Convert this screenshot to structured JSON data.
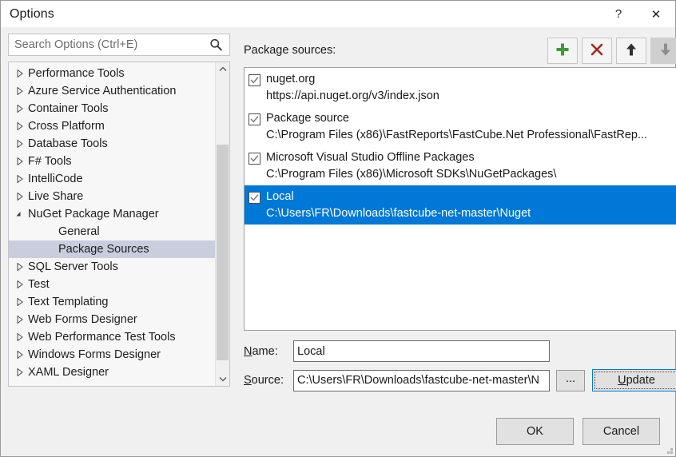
{
  "window": {
    "title": "Options",
    "help_button": "?",
    "close_button": "✕"
  },
  "search": {
    "placeholder": "Search Options (Ctrl+E)",
    "value": "",
    "icon": "search-icon"
  },
  "tree": {
    "items": [
      {
        "label": "Performance Tools",
        "state": "collapsed",
        "level": 0,
        "selected": false
      },
      {
        "label": "Azure Service Authentication",
        "state": "collapsed",
        "level": 0,
        "selected": false
      },
      {
        "label": "Container Tools",
        "state": "collapsed",
        "level": 0,
        "selected": false
      },
      {
        "label": "Cross Platform",
        "state": "collapsed",
        "level": 0,
        "selected": false
      },
      {
        "label": "Database Tools",
        "state": "collapsed",
        "level": 0,
        "selected": false
      },
      {
        "label": "F# Tools",
        "state": "collapsed",
        "level": 0,
        "selected": false
      },
      {
        "label": "IntelliCode",
        "state": "collapsed",
        "level": 0,
        "selected": false
      },
      {
        "label": "Live Share",
        "state": "collapsed",
        "level": 0,
        "selected": false
      },
      {
        "label": "NuGet Package Manager",
        "state": "expanded",
        "level": 0,
        "selected": false
      },
      {
        "label": "General",
        "state": "leaf",
        "level": 1,
        "selected": false
      },
      {
        "label": "Package Sources",
        "state": "leaf",
        "level": 1,
        "selected": true
      },
      {
        "label": "SQL Server Tools",
        "state": "collapsed",
        "level": 0,
        "selected": false
      },
      {
        "label": "Test",
        "state": "collapsed",
        "level": 0,
        "selected": false
      },
      {
        "label": "Text Templating",
        "state": "collapsed",
        "level": 0,
        "selected": false
      },
      {
        "label": "Web Forms Designer",
        "state": "collapsed",
        "level": 0,
        "selected": false
      },
      {
        "label": "Web Performance Test Tools",
        "state": "collapsed",
        "level": 0,
        "selected": false
      },
      {
        "label": "Windows Forms Designer",
        "state": "collapsed",
        "level": 0,
        "selected": false
      },
      {
        "label": "XAML Designer",
        "state": "collapsed",
        "level": 0,
        "selected": false
      }
    ],
    "scrollbar": {
      "up_icon": "chevron-up-icon",
      "down_icon": "chevron-down-icon"
    }
  },
  "packages": {
    "header_label": "Package sources:",
    "toolbar": [
      {
        "name": "add-package-source-button",
        "icon": "plus-icon",
        "color": "#3d9b35",
        "disabled": false
      },
      {
        "name": "remove-package-source-button",
        "icon": "x-icon",
        "color": "#a02b17",
        "disabled": false
      },
      {
        "name": "move-up-button",
        "icon": "arrow-up-icon",
        "color": "#303030",
        "disabled": false
      },
      {
        "name": "move-down-button",
        "icon": "arrow-down-icon",
        "color": "#8d8d8d",
        "disabled": true
      }
    ],
    "sources": [
      {
        "name": "nuget.org",
        "url": "https://api.nuget.org/v3/index.json",
        "checked": true,
        "selected": false
      },
      {
        "name": "Package source",
        "url": "C:\\Program  Files  (x86)\\FastReports\\FastCube.Net  Professional\\FastRep...",
        "checked": true,
        "selected": false
      },
      {
        "name": "Microsoft Visual Studio Offline Packages",
        "url": "C:\\Program Files (x86)\\Microsoft SDKs\\NuGetPackages\\",
        "checked": true,
        "selected": false
      },
      {
        "name": "Local",
        "url": "C:\\Users\\FR\\Downloads\\fastcube-net-master\\Nuget",
        "checked": true,
        "selected": true
      }
    ],
    "selection_color": "#0078d7"
  },
  "form": {
    "name_label_prefix": "",
    "name_label_accesskey": "N",
    "name_label_suffix": "ame:",
    "name_value": "Local",
    "source_label_accesskey": "S",
    "source_label_suffix": "ource:",
    "source_value": "C:\\Users\\FR\\Downloads\\fastcube-net-master\\N",
    "browse_label": "...",
    "update_accesskey": "U",
    "update_suffix": "pdate"
  },
  "footer": {
    "ok_label": "OK",
    "cancel_label": "Cancel",
    "resize_grip": "resize-grip"
  }
}
